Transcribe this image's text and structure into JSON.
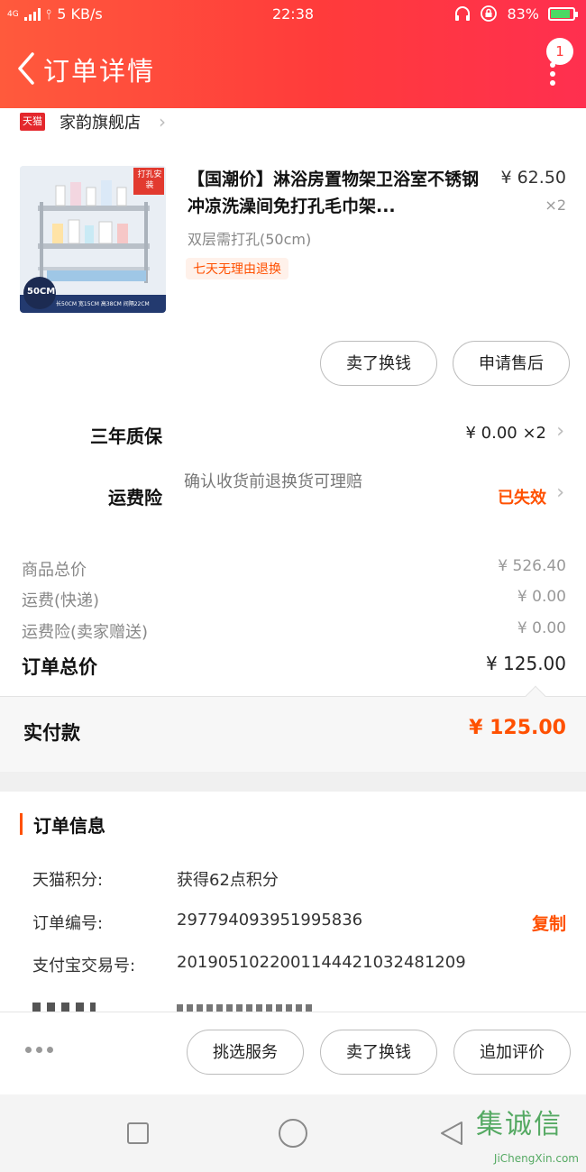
{
  "status_bar": {
    "network": "4G",
    "speed": "5 KB/s",
    "time": "22:38",
    "battery": "83%"
  },
  "nav": {
    "title": "订单详情",
    "badge_count": "1"
  },
  "shop": {
    "platform_logo": "天猫",
    "name": "家韵旗舰店"
  },
  "product": {
    "title": "【国潮价】淋浴房置物架卫浴室不锈钢冲凉洗澡间免打孔毛巾架...",
    "sku": "双层需打孔(50cm)",
    "tag": "七天无理由退换",
    "price": "¥ 62.50",
    "qty": "×2",
    "thumb_badge_size": "50CM",
    "thumb_corner_label": "打孔安装",
    "thumb_spec": "长50CM 宽15CM 高38CM 间隔22CM"
  },
  "actions": {
    "sell_exchange": "卖了换钱",
    "after_sales": "申请售后"
  },
  "services": {
    "warranty_label": "三年质保",
    "warranty_value": "¥ 0.00 ×2",
    "shipping_ins_label": "运费险",
    "shipping_ins_desc": "确认收货前退换货可理赔",
    "shipping_ins_status": "已失效"
  },
  "fees": {
    "goods_total_label": "商品总价",
    "goods_total_value": "¥ 526.40",
    "shipping_label": "运费(快递)",
    "shipping_value": "¥ 0.00",
    "insurance_label": "运费险(卖家赠送)",
    "insurance_value": "¥ 0.00",
    "order_total_label": "订单总价",
    "order_total_value": "¥ 125.00"
  },
  "paid": {
    "label": "实付款",
    "value": "¥ 125.00"
  },
  "order_info": {
    "title": "订单信息",
    "points_label": "天猫积分:",
    "points_value": "获得62点积分",
    "order_no_label": "订单编号:",
    "order_no_value": "297794093951995836",
    "copy_label": "复制",
    "alipay_label": "支付宝交易号:",
    "alipay_value": "2019051022001144421032481209"
  },
  "bottom_actions": {
    "select_service": "挑选服务",
    "sell_exchange": "卖了换钱",
    "add_review": "追加评价"
  },
  "watermark": {
    "cn": "集诚信",
    "en": "JiChengXin.com"
  },
  "colors": {
    "header_red": "#ff3b3b",
    "accent_orange": "#ff5000"
  }
}
